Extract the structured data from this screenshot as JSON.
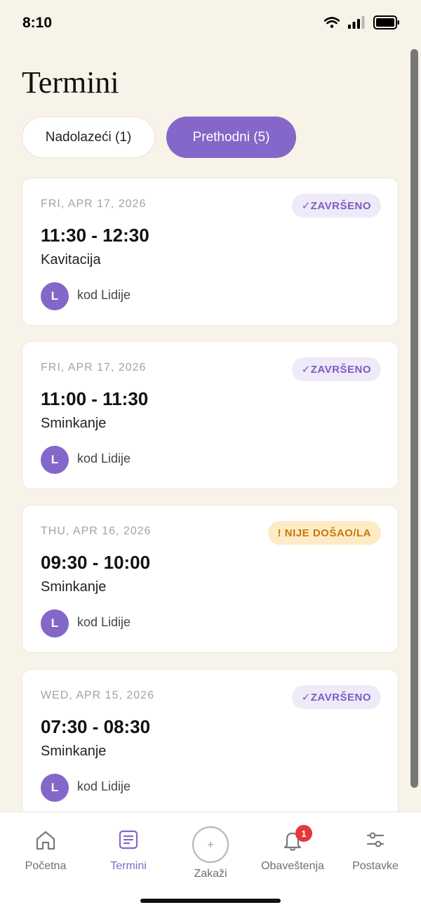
{
  "status_bar": {
    "time": "8:10"
  },
  "page": {
    "title": "Termini"
  },
  "tabs": [
    {
      "label": "Nadolazeći (1)",
      "active": false
    },
    {
      "label": "Prethodni (5)",
      "active": true
    }
  ],
  "appointments": [
    {
      "date": "FRI, APR 17, 2026",
      "time": "11:30 - 12:30",
      "service": "Kavitacija",
      "avatar_initial": "L",
      "provider": "kod Lidije",
      "status": "✓ZAVRŠENO",
      "status_type": "done"
    },
    {
      "date": "FRI, APR 17, 2026",
      "time": "11:00 - 11:30",
      "service": "Sminkanje",
      "avatar_initial": "L",
      "provider": "kod Lidije",
      "status": "✓ZAVRŠENO",
      "status_type": "done"
    },
    {
      "date": "THU, APR 16, 2026",
      "time": "09:30 - 10:00",
      "service": "Sminkanje",
      "avatar_initial": "L",
      "provider": "kod Lidije",
      "status": "! NIJE DOŠAO/LA",
      "status_type": "noshow"
    },
    {
      "date": "WED, APR 15, 2026",
      "time": "07:30 - 08:30",
      "service": "Sminkanje",
      "avatar_initial": "L",
      "provider": "kod Lidije",
      "status": "✓ZAVRŠENO",
      "status_type": "done"
    }
  ],
  "bottom_nav": {
    "home": {
      "label": "Početna",
      "icon": "home-icon"
    },
    "appointments": {
      "label": "Termini",
      "icon": "list-icon"
    },
    "book": {
      "label": "Zakaži",
      "icon": "plus-icon"
    },
    "notifications": {
      "label": "Obaveštenja",
      "icon": "bell-icon",
      "count": "1"
    },
    "settings": {
      "label": "Postavke",
      "icon": "sliders-icon"
    }
  },
  "colors": {
    "accent": "#8467c9",
    "background": "#f7f3e8",
    "done_badge_bg": "#efeaf8",
    "noshow_badge_bg": "#fdebc6",
    "noshow_text": "#c8780a",
    "notification": "#e5383b"
  }
}
